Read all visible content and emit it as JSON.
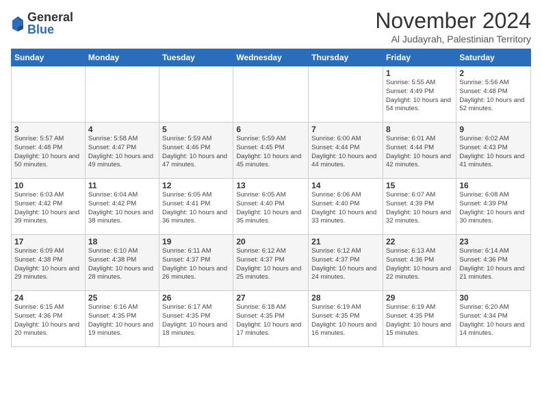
{
  "header": {
    "logo_general": "General",
    "logo_blue": "Blue",
    "month_title": "November 2024",
    "location": "Al Judayrah, Palestinian Territory"
  },
  "weekdays": [
    "Sunday",
    "Monday",
    "Tuesday",
    "Wednesday",
    "Thursday",
    "Friday",
    "Saturday"
  ],
  "weeks": [
    [
      {
        "day": "",
        "info": ""
      },
      {
        "day": "",
        "info": ""
      },
      {
        "day": "",
        "info": ""
      },
      {
        "day": "",
        "info": ""
      },
      {
        "day": "",
        "info": ""
      },
      {
        "day": "1",
        "info": "Sunrise: 5:55 AM\nSunset: 4:49 PM\nDaylight: 10 hours and 54 minutes."
      },
      {
        "day": "2",
        "info": "Sunrise: 5:56 AM\nSunset: 4:48 PM\nDaylight: 10 hours and 52 minutes."
      }
    ],
    [
      {
        "day": "3",
        "info": "Sunrise: 5:57 AM\nSunset: 4:48 PM\nDaylight: 10 hours and 50 minutes."
      },
      {
        "day": "4",
        "info": "Sunrise: 5:58 AM\nSunset: 4:47 PM\nDaylight: 10 hours and 49 minutes."
      },
      {
        "day": "5",
        "info": "Sunrise: 5:59 AM\nSunset: 4:46 PM\nDaylight: 10 hours and 47 minutes."
      },
      {
        "day": "6",
        "info": "Sunrise: 5:59 AM\nSunset: 4:45 PM\nDaylight: 10 hours and 45 minutes."
      },
      {
        "day": "7",
        "info": "Sunrise: 6:00 AM\nSunset: 4:44 PM\nDaylight: 10 hours and 44 minutes."
      },
      {
        "day": "8",
        "info": "Sunrise: 6:01 AM\nSunset: 4:44 PM\nDaylight: 10 hours and 42 minutes."
      },
      {
        "day": "9",
        "info": "Sunrise: 6:02 AM\nSunset: 4:43 PM\nDaylight: 10 hours and 41 minutes."
      }
    ],
    [
      {
        "day": "10",
        "info": "Sunrise: 6:03 AM\nSunset: 4:42 PM\nDaylight: 10 hours and 39 minutes."
      },
      {
        "day": "11",
        "info": "Sunrise: 6:04 AM\nSunset: 4:42 PM\nDaylight: 10 hours and 38 minutes."
      },
      {
        "day": "12",
        "info": "Sunrise: 6:05 AM\nSunset: 4:41 PM\nDaylight: 10 hours and 36 minutes."
      },
      {
        "day": "13",
        "info": "Sunrise: 6:05 AM\nSunset: 4:40 PM\nDaylight: 10 hours and 35 minutes."
      },
      {
        "day": "14",
        "info": "Sunrise: 6:06 AM\nSunset: 4:40 PM\nDaylight: 10 hours and 33 minutes."
      },
      {
        "day": "15",
        "info": "Sunrise: 6:07 AM\nSunset: 4:39 PM\nDaylight: 10 hours and 32 minutes."
      },
      {
        "day": "16",
        "info": "Sunrise: 6:08 AM\nSunset: 4:39 PM\nDaylight: 10 hours and 30 minutes."
      }
    ],
    [
      {
        "day": "17",
        "info": "Sunrise: 6:09 AM\nSunset: 4:38 PM\nDaylight: 10 hours and 29 minutes."
      },
      {
        "day": "18",
        "info": "Sunrise: 6:10 AM\nSunset: 4:38 PM\nDaylight: 10 hours and 28 minutes."
      },
      {
        "day": "19",
        "info": "Sunrise: 6:11 AM\nSunset: 4:37 PM\nDaylight: 10 hours and 26 minutes."
      },
      {
        "day": "20",
        "info": "Sunrise: 6:12 AM\nSunset: 4:37 PM\nDaylight: 10 hours and 25 minutes."
      },
      {
        "day": "21",
        "info": "Sunrise: 6:12 AM\nSunset: 4:37 PM\nDaylight: 10 hours and 24 minutes."
      },
      {
        "day": "22",
        "info": "Sunrise: 6:13 AM\nSunset: 4:36 PM\nDaylight: 10 hours and 22 minutes."
      },
      {
        "day": "23",
        "info": "Sunrise: 6:14 AM\nSunset: 4:36 PM\nDaylight: 10 hours and 21 minutes."
      }
    ],
    [
      {
        "day": "24",
        "info": "Sunrise: 6:15 AM\nSunset: 4:36 PM\nDaylight: 10 hours and 20 minutes."
      },
      {
        "day": "25",
        "info": "Sunrise: 6:16 AM\nSunset: 4:35 PM\nDaylight: 10 hours and 19 minutes."
      },
      {
        "day": "26",
        "info": "Sunrise: 6:17 AM\nSunset: 4:35 PM\nDaylight: 10 hours and 18 minutes."
      },
      {
        "day": "27",
        "info": "Sunrise: 6:18 AM\nSunset: 4:35 PM\nDaylight: 10 hours and 17 minutes."
      },
      {
        "day": "28",
        "info": "Sunrise: 6:19 AM\nSunset: 4:35 PM\nDaylight: 10 hours and 16 minutes."
      },
      {
        "day": "29",
        "info": "Sunrise: 6:19 AM\nSunset: 4:35 PM\nDaylight: 10 hours and 15 minutes."
      },
      {
        "day": "30",
        "info": "Sunrise: 6:20 AM\nSunset: 4:34 PM\nDaylight: 10 hours and 14 minutes."
      }
    ]
  ]
}
